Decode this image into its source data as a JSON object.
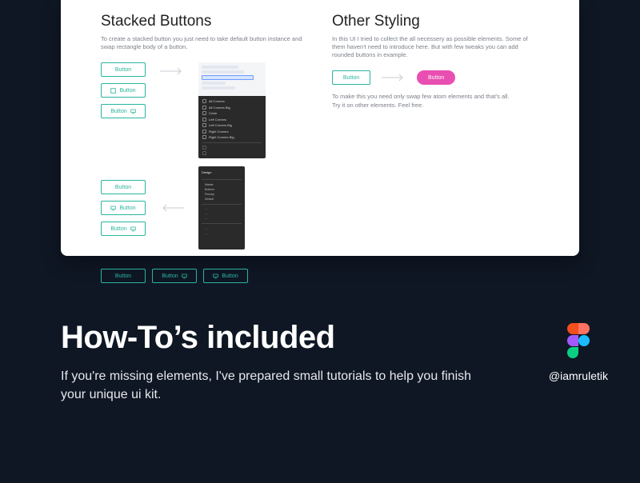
{
  "left": {
    "title": "Stacked Buttons",
    "desc": "To create a stacked button you just need to take default button instance and swap rectangle body of a button.",
    "btn_basic": "Button",
    "radius_items": [
      "All Corners",
      "All Corners Big",
      "Circle",
      "Left Corners",
      "Left Corners Big",
      "Right Corners",
      "Right Corners Big"
    ],
    "design_title": "Design",
    "panel_items": [
      "Master",
      "Buttons",
      "Primary",
      "Default"
    ]
  },
  "right": {
    "title": "Other Styling",
    "desc": "In this UI I tried to collect the all necessery as possible elements. Some of them haven't need to introduce here. But with few tweaks you can add rounded buttons in example.",
    "btn": "Button",
    "pill": "Button",
    "note1": "To make this you need only swap few atom elements and that's all.",
    "note2": "Try it on other elements. Feel free."
  },
  "footer": {
    "title": "How-To’s included",
    "sub": "If you're missing elements, I've prepared small tutorials to help you finish your unique ui kit.",
    "handle": "@iamruletik"
  }
}
